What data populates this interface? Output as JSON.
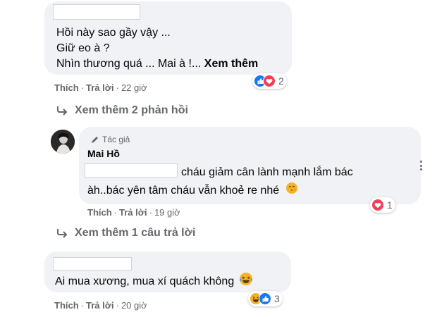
{
  "comment1": {
    "lines": [
      "Hồi này sao gầy vậy ...",
      "Giữ eo à ?",
      "Nhìn thương quá ... Mai à !..."
    ],
    "see_more": "Xem thêm",
    "actions": {
      "like": "Thích",
      "reply": "Trả lời",
      "time": "22 giờ"
    },
    "reaction_count": "2",
    "reaction_icons": [
      "like-icon",
      "love-icon"
    ]
  },
  "view_more_replies_1": "Xem thêm 2 phản hồi",
  "reply1": {
    "author_badge": "Tác giả",
    "author_name": "Mai Hồ",
    "lines": [
      "cháu giảm cân lành mạnh lắm bác",
      "àh..bác yên tâm cháu vẫn khoẻ re nhé"
    ],
    "emoji": "face-blowing-kiss-icon",
    "actions": {
      "like": "Thích",
      "reply": "Trả lời",
      "time": "19 giờ"
    },
    "reaction_count": "1",
    "reaction_icons": [
      "love-icon"
    ]
  },
  "view_more_replies_2": "Xem thêm 1 câu trả lời",
  "comment2": {
    "text": "Ai mua xương, mua xí quách không",
    "emoji": "laughing-tears-icon",
    "actions": {
      "like": "Thích",
      "reply": "Trả lời",
      "time": "20 giờ"
    },
    "reaction_count": "3",
    "reaction_icons": [
      "haha-icon",
      "like-icon"
    ]
  },
  "colors": {
    "bubble": "#f0f2f5",
    "like_blue": "#1877f2",
    "love_red": "#f33e58",
    "secondary_text": "#65676b"
  }
}
